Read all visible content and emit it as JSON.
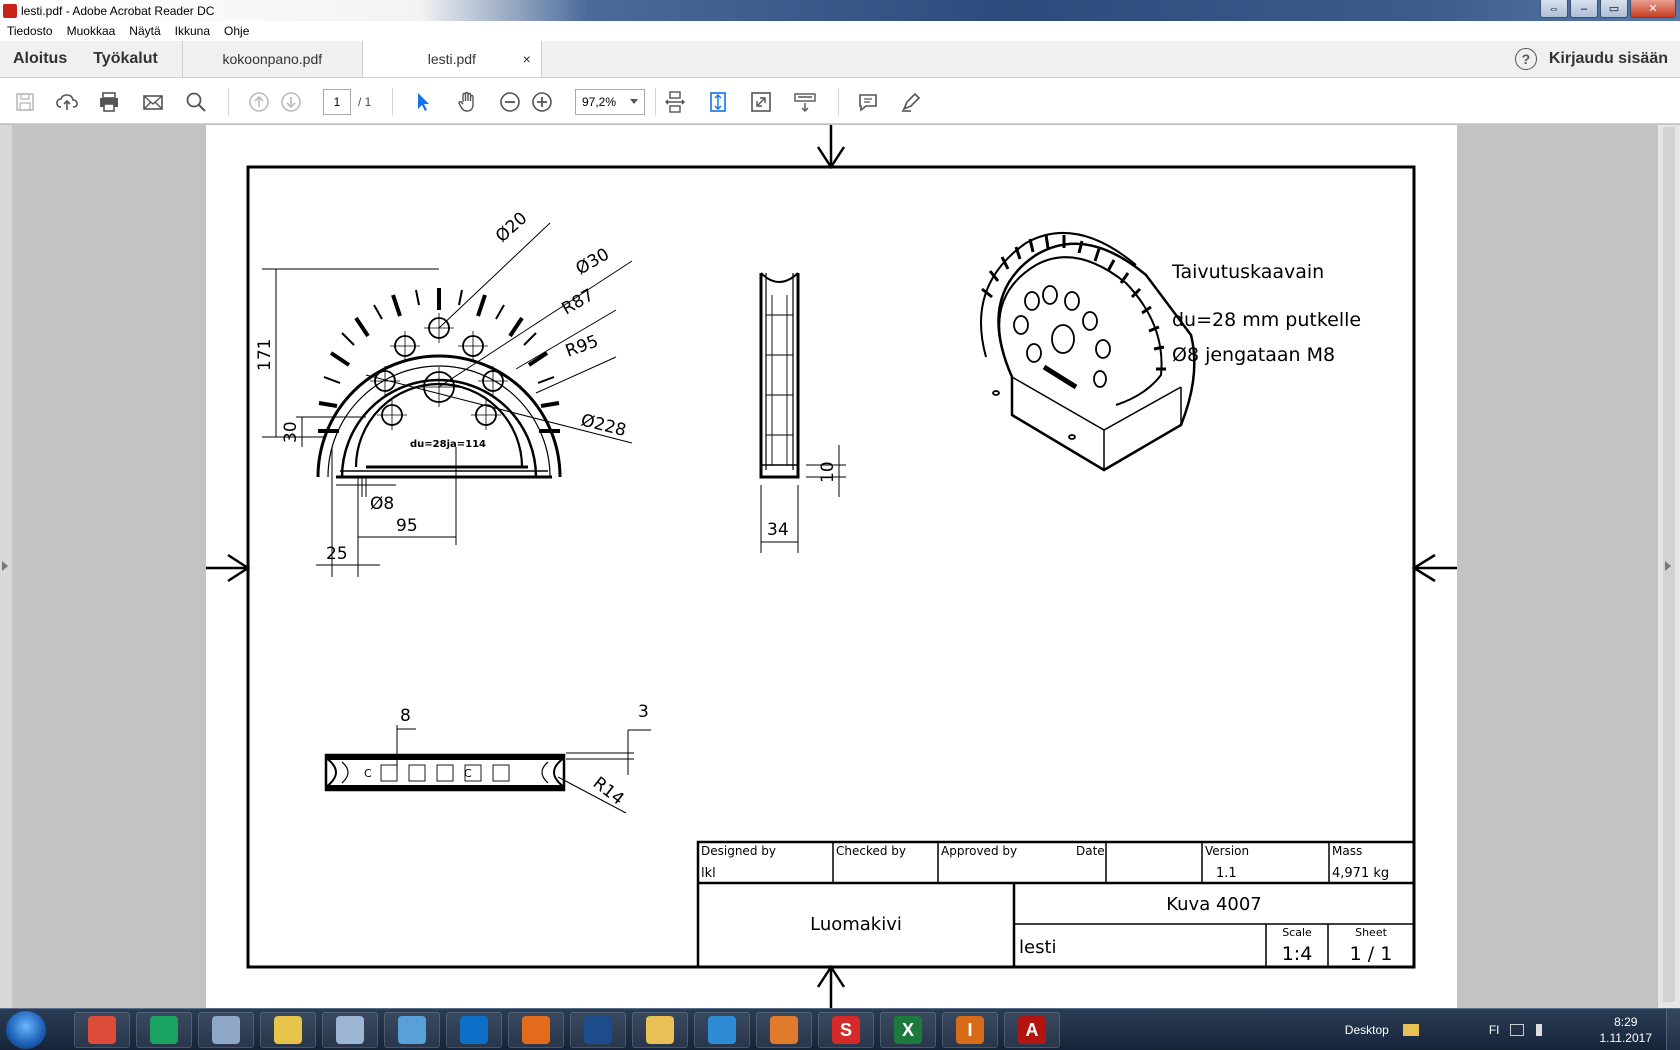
{
  "window": {
    "title": "lesti.pdf - Adobe Acrobat Reader DC",
    "controls": {
      "restore": "⇔",
      "minimize": "–",
      "maximize": "▭",
      "close": "✕"
    }
  },
  "menu": [
    "Tiedosto",
    "Muokkaa",
    "Näytä",
    "Ikkuna",
    "Ohje"
  ],
  "tabs": {
    "home": "Aloitus",
    "tools": "Työkalut",
    "documents": [
      {
        "label": "kokoonpano.pdf",
        "active": false
      },
      {
        "label": "lesti.pdf",
        "active": true
      }
    ],
    "close_glyph": "×",
    "help": "?",
    "signin": "Kirjaudu sisään"
  },
  "toolbar": {
    "page_current": "1",
    "page_total": "/ 1",
    "zoom": "97,2%"
  },
  "drawing": {
    "dims": {
      "d20": "Ø20",
      "d30": "Ø30",
      "r87": "R87",
      "r95": "R95",
      "d228": "Ø228",
      "h171": "171",
      "h30": "30",
      "d8": "Ø8",
      "w95": "95",
      "w25": "25",
      "w34": "34",
      "h10": "10",
      "t8": "8",
      "t3": "3",
      "r14": "R14"
    },
    "engraving": "du=28ja=114",
    "notes": [
      "Taivutuskaavain",
      "du=28 mm putkelle",
      "Ø8 jengataan M8"
    ],
    "centerline_mark": "C"
  },
  "title_block": {
    "designed_by_label": "Designed by",
    "designed_by": "lkl",
    "checked_by_label": "Checked by",
    "approved_by_label": "Approved by",
    "date_label": "Date",
    "version_label": "Version",
    "version": "1.1",
    "mass_label": "Mass",
    "mass": "4,971 kg",
    "company": "Luomakivi",
    "drawing_title": "Kuva 4007",
    "part_name": "lesti",
    "scale_label": "Scale",
    "scale": "1:4",
    "sheet_label": "Sheet",
    "sheet": "1 / 1"
  },
  "taskbar": {
    "desktop_label": "Desktop",
    "language": "FI",
    "time": "8:29",
    "date": "1.11.2017",
    "apps": [
      {
        "name": "chrome",
        "color": "#dd4b39"
      },
      {
        "name": "opera",
        "color": "#1aa260"
      },
      {
        "name": "tool",
        "color": "#8fa8c8"
      },
      {
        "name": "paint",
        "color": "#e6c34a"
      },
      {
        "name": "calculator",
        "color": "#9db6d3"
      },
      {
        "name": "mirror",
        "color": "#5aa0d8"
      },
      {
        "name": "teamviewer",
        "color": "#0e6fc8"
      },
      {
        "name": "firefox",
        "color": "#e36b1b"
      },
      {
        "name": "solitaire",
        "color": "#1c4c8a"
      },
      {
        "name": "explorer",
        "color": "#e8c056"
      },
      {
        "name": "network",
        "color": "#2e8bd6"
      },
      {
        "name": "office",
        "color": "#e07a2c"
      },
      {
        "name": "s-app",
        "color": "#d42a2a",
        "glyph": "S"
      },
      {
        "name": "excel",
        "color": "#1e7a3c",
        "glyph": "X"
      },
      {
        "name": "inventor",
        "color": "#d76b1a",
        "glyph": "I"
      },
      {
        "name": "acrobat",
        "color": "#b3140f",
        "glyph": "A"
      }
    ]
  }
}
